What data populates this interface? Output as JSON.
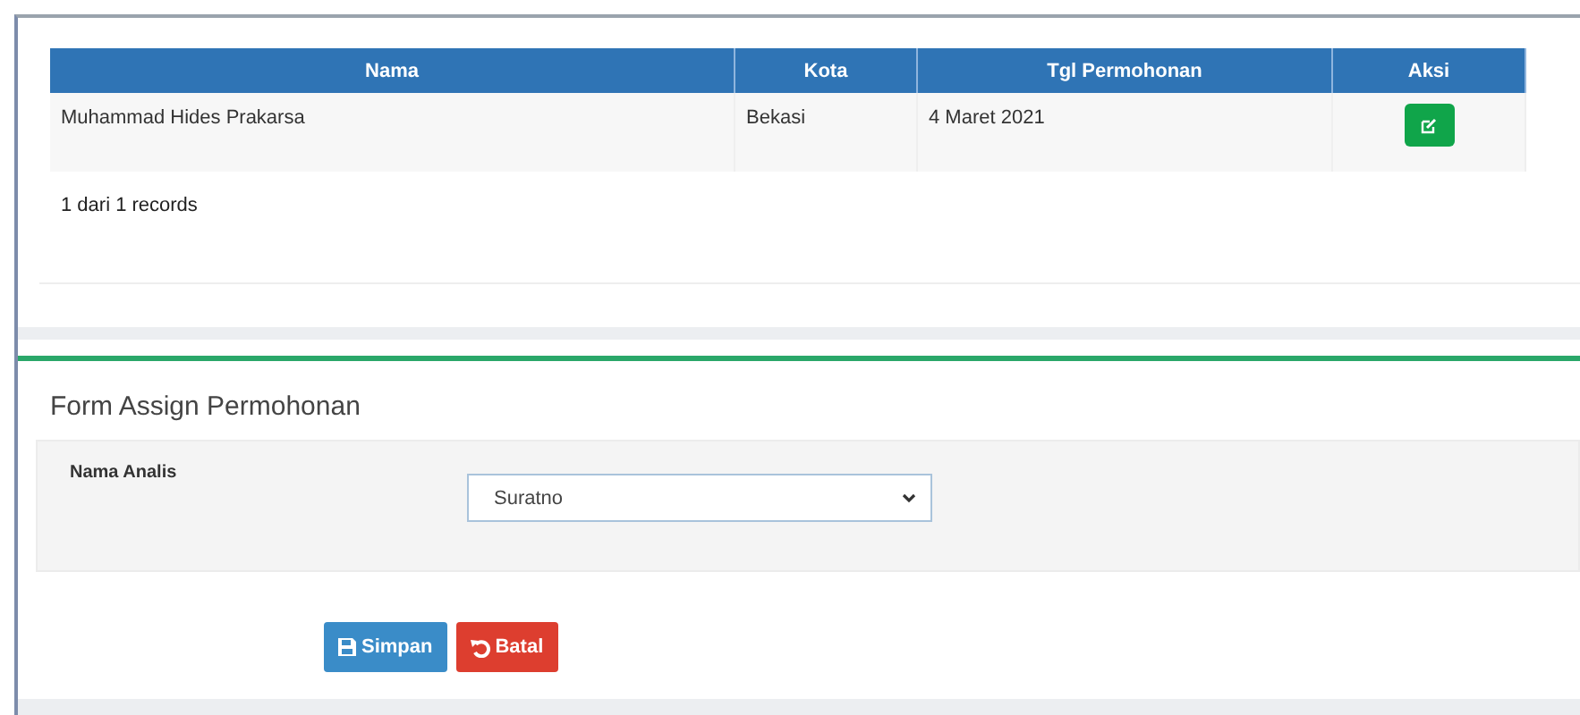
{
  "table": {
    "columns": [
      "Nama",
      "Kota",
      "Tgl Permohonan",
      "Aksi"
    ],
    "rows": [
      {
        "cells": [
          "Muhammad Hides Prakarsa",
          "Bekasi",
          "4 Maret 2021"
        ]
      }
    ],
    "footer": "1 dari 1 records"
  },
  "form": {
    "title": "Form Assign Permohonan",
    "label": "Nama Analis",
    "value": "Suratno"
  },
  "buttons": [
    {
      "kind": "save",
      "label": "Simpan"
    },
    {
      "kind": "cancel",
      "label": "Batal"
    }
  ]
}
